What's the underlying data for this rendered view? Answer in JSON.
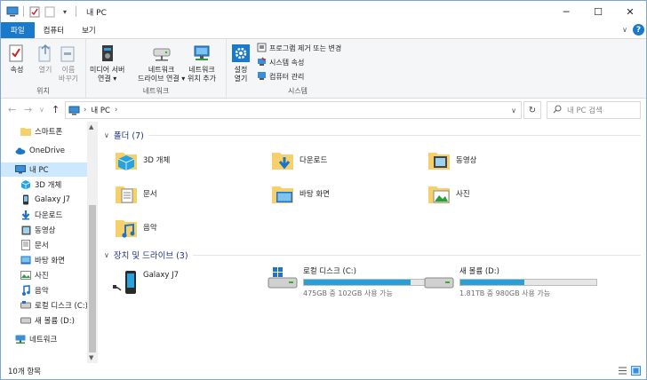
{
  "window": {
    "title": "내 PC"
  },
  "ribbon_tabs": [
    "파일",
    "컴퓨터",
    "보기"
  ],
  "ribbon": {
    "location_group": {
      "label": "위치",
      "properties": "속성",
      "open": "열기",
      "rename_1": "이름",
      "rename_2": "바꾸기"
    },
    "network_group": {
      "label": "네트워크",
      "media_1": "미디어 서버",
      "media_2": "연결",
      "netdrive_1": "네트워크",
      "netdrive_2": "드라이브 연결",
      "netloc_1": "네트워크",
      "netloc_2": "위치 추가"
    },
    "system_group": {
      "label": "시스템",
      "settings_1": "설정",
      "settings_2": "열기",
      "uninstall": "프로그램 제거 또는 변경",
      "sys_props": "시스템 속성",
      "manage": "컴퓨터 관리"
    }
  },
  "address": {
    "path_root": "내 PC",
    "search_placeholder": "내 PC 검색"
  },
  "nav": {
    "items": [
      {
        "label": "스마트폰",
        "icon": "folder-icon"
      },
      {
        "label": "OneDrive",
        "icon": "cloud-icon"
      },
      {
        "label": "내 PC",
        "icon": "computer-icon"
      },
      {
        "label": "3D 개체",
        "icon": "cube-icon"
      },
      {
        "label": "Galaxy J7",
        "icon": "phone-icon"
      },
      {
        "label": "다운로드",
        "icon": "download-icon"
      },
      {
        "label": "동영상",
        "icon": "video-icon"
      },
      {
        "label": "문서",
        "icon": "document-icon"
      },
      {
        "label": "바탕 화면",
        "icon": "desktop-icon"
      },
      {
        "label": "사진",
        "icon": "picture-icon"
      },
      {
        "label": "음악",
        "icon": "music-icon"
      },
      {
        "label": "로컬 디스크 (C:)",
        "icon": "drive-icon"
      },
      {
        "label": "새 볼륨 (D:)",
        "icon": "drive-icon"
      },
      {
        "label": "네트워크",
        "icon": "network-icon"
      }
    ]
  },
  "content": {
    "folders_header": "폴더 (7)",
    "folders": [
      "3D 개체",
      "다운로드",
      "동영상",
      "문서",
      "바탕 화면",
      "사진",
      "음악"
    ],
    "devices_header": "장치 및 드라이브 (3)",
    "devices": [
      {
        "name": "Galaxy J7"
      },
      {
        "name": "로컬 디스크 (C:)",
        "info": "475GB 중 102GB 사용 가능",
        "used_fraction": 0.785
      },
      {
        "name": "새 볼륨 (D:)",
        "info": "1.81TB 중 980GB 사용 가능",
        "used_fraction": 0.47
      }
    ]
  },
  "status": {
    "count": "10개 항목"
  },
  "colors": {
    "accent": "#1979ca",
    "folder": "#f6d16b",
    "bar_fill": "#26a0da",
    "selection": "#cce8ff"
  }
}
